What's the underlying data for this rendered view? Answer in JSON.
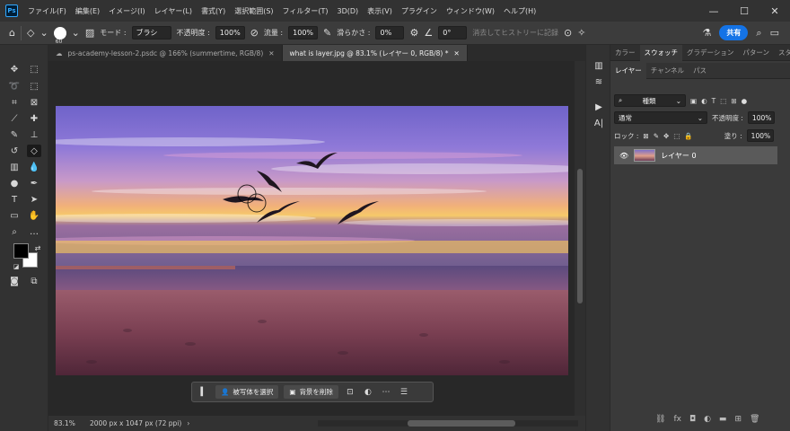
{
  "app": {
    "logo": "Ps",
    "menu": [
      "ファイル(F)",
      "編集(E)",
      "イメージ(I)",
      "レイヤー(L)",
      "書式(Y)",
      "選択範囲(S)",
      "フィルター(T)",
      "3D(D)",
      "表示(V)",
      "プラグイン",
      "ウィンドウ(W)",
      "ヘルプ(H)"
    ],
    "window_controls": [
      "—",
      "☐",
      "✕"
    ]
  },
  "options": {
    "brush_size": "60",
    "mode_label": "モード :",
    "mode_value": "ブラシ",
    "opacity_label": "不透明度 :",
    "opacity_value": "100%",
    "flow_label": "流量 :",
    "flow_value": "100%",
    "smoothing_label": "滑らかさ :",
    "smoothing_value": "0%",
    "angle_value": "0°",
    "history_label": "消去してヒストリーに記録",
    "share_label": "共有"
  },
  "tabs": [
    {
      "label": "ps-academy-lesson-2.psdc @ 166% (summertime, RGB/8)",
      "active": false
    },
    {
      "label": "what is layer.jpg @ 83.1% (レイヤー 0, RGB/8) *",
      "active": true
    }
  ],
  "context_bar": {
    "select_subject": "被写体を選択",
    "remove_bg": "背景を削除"
  },
  "status": {
    "zoom": "83.1%",
    "doc_info": "2000 px x 1047 px (72 ppi)"
  },
  "panel": {
    "top_tabs": [
      "カラー",
      "スウォッチ",
      "グラデーション",
      "パターン",
      "スタイル"
    ],
    "layer_tabs": [
      "レイヤー",
      "チャンネル",
      "パス"
    ],
    "filter_kind": "種類",
    "blend_mode": "通常",
    "opacity_label": "不透明度 :",
    "opacity_value": "100%",
    "lock_label": "ロック :",
    "fill_label": "塗り :",
    "fill_value": "100%",
    "layer_name": "レイヤー 0"
  }
}
